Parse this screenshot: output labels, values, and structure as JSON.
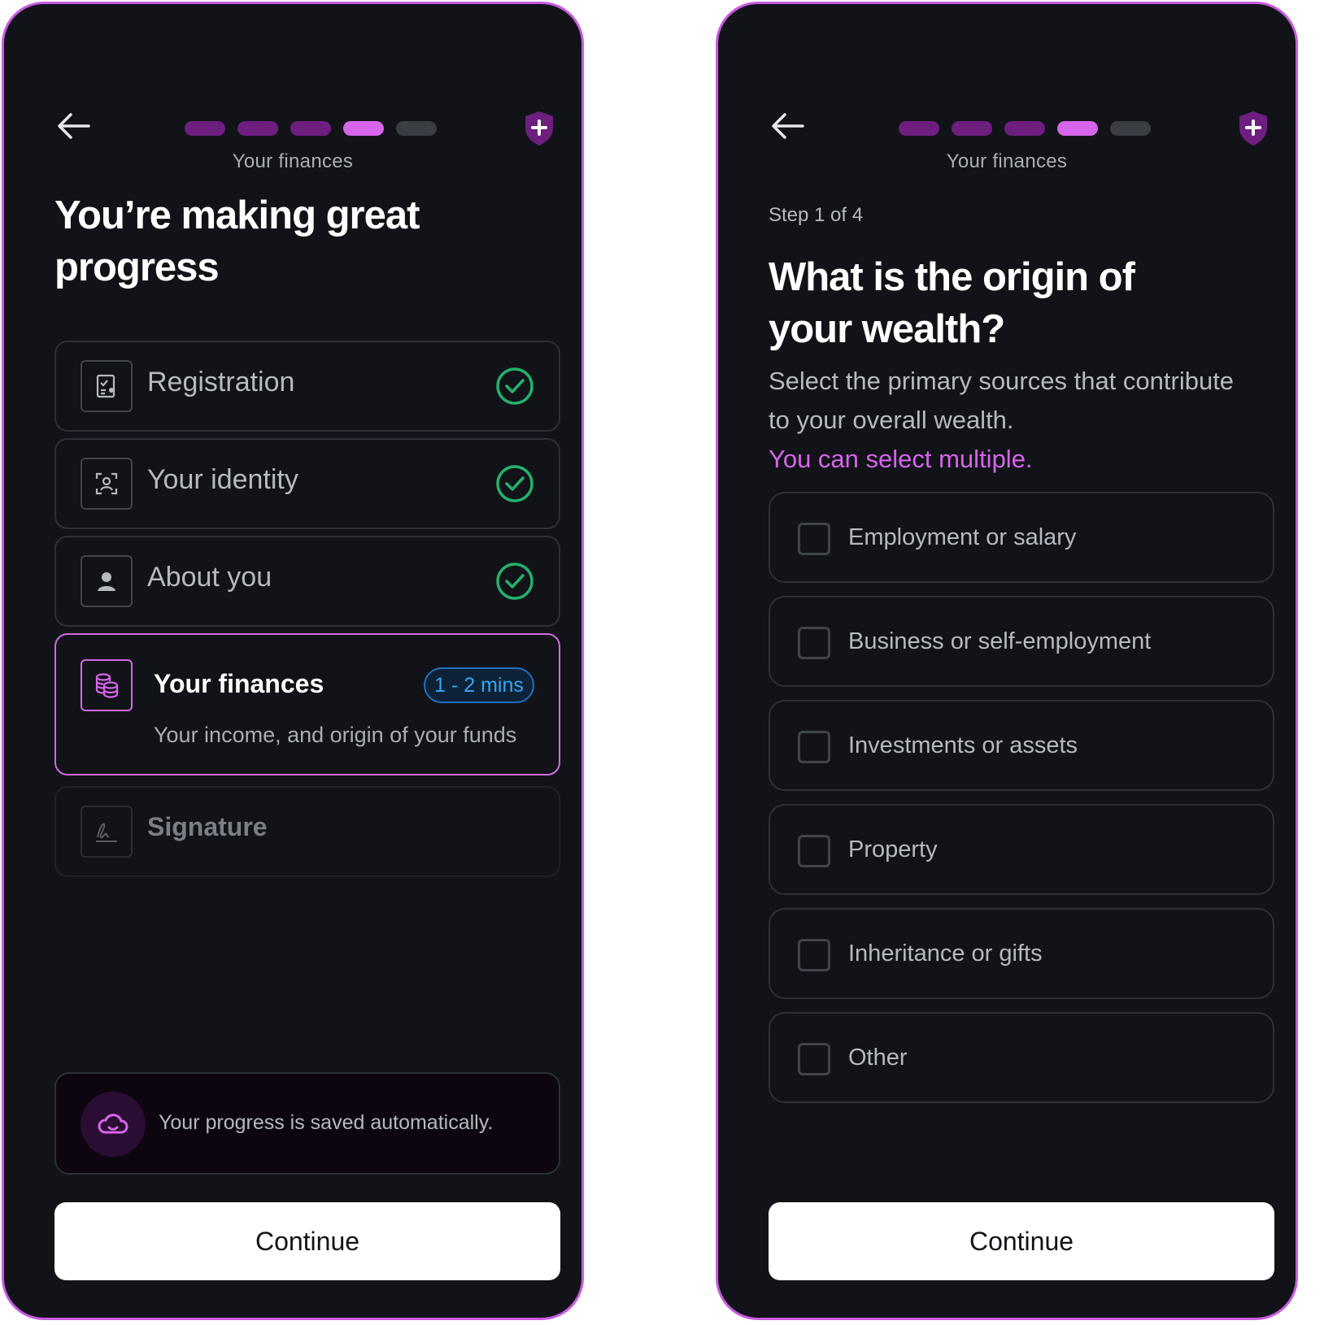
{
  "screen1": {
    "section_label": "Your finances",
    "progress": {
      "total_steps": 5,
      "completed": 3,
      "current_index": 3
    },
    "headline_line1": "You’re making great",
    "headline_line2": "progress",
    "steps": [
      {
        "label": "Registration",
        "status": "complete",
        "icon": "document-check-icon"
      },
      {
        "label": "Your identity",
        "status": "complete",
        "icon": "face-scan-icon"
      },
      {
        "label": "About you",
        "status": "complete",
        "icon": "user-icon"
      },
      {
        "label": "Your finances",
        "status": "current",
        "icon": "coins-stack-icon",
        "badge": "1 - 2 mins",
        "subtitle": "Your income, and origin of your funds"
      },
      {
        "label": "Signature",
        "status": "locked",
        "icon": "signature-icon"
      }
    ],
    "saved_note": "Your progress is saved automatically.",
    "continue_label": "Continue"
  },
  "screen2": {
    "section_label": "Your finances",
    "progress": {
      "total_steps": 5,
      "completed": 3,
      "current_index": 3
    },
    "step_label": "Step 1 of 4",
    "question_line1": "What is the origin of",
    "question_line2": "your wealth?",
    "description": "Select the primary sources that contribute to your overall wealth.",
    "hint": "You can select multiple.",
    "options": [
      {
        "label": "Employment or salary",
        "checked": false
      },
      {
        "label": "Business or self-employment",
        "checked": false
      },
      {
        "label": "Investments or assets",
        "checked": false
      },
      {
        "label": "Property",
        "checked": false
      },
      {
        "label": "Inheritance or gifts",
        "checked": false
      },
      {
        "label": "Other",
        "checked": false
      }
    ],
    "continue_label": "Continue"
  },
  "colors": {
    "background": "#111318",
    "frame": "#c95be0",
    "accent": "#d765eb",
    "progress_done": "#6d1e7f",
    "success": "#22b26c",
    "badge": "#35a6f5"
  }
}
